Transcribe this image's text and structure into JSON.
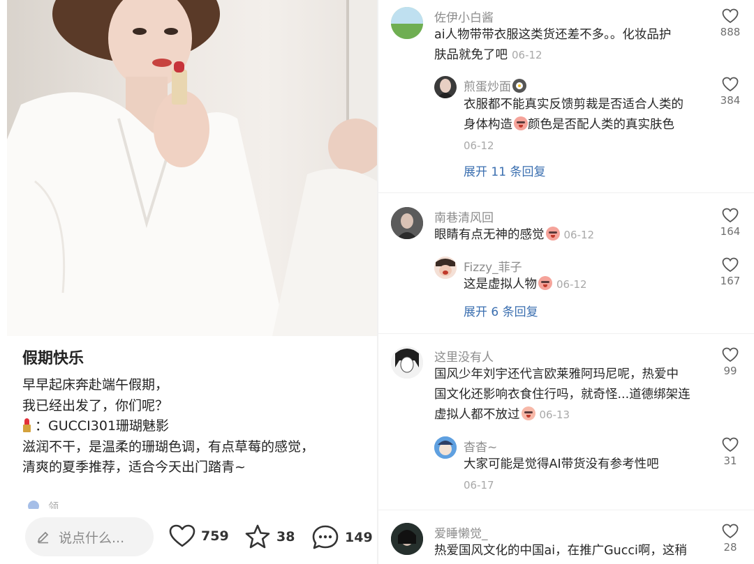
{
  "post": {
    "title": "假期快乐",
    "lines": [
      "早早起床奔赴端午假期，",
      "我已经出发了，你们呢？",
      "：GUCCI301珊瑚魅影",
      "滋润不干，是温柔的珊瑚色调，有点草莓的感觉，",
      "清爽的夏季推荐，适合今天出门踏青~"
    ],
    "lipstick_icon": "lipstick-emoji",
    "faded_text": "领"
  },
  "bottom_bar": {
    "say_placeholder": "说点什么...",
    "like_count": "759",
    "star_count": "38",
    "comment_count": "149"
  },
  "comments": [
    {
      "user": "佐伊小白酱",
      "lines": [
        "ai人物带带衣服这类货还差不多。。化妆品护",
        "肤品就免了吧"
      ],
      "date": "06-12",
      "likes": "888",
      "avatar_color": "#7fb36a",
      "replies": [
        {
          "user": "煎蛋炒面",
          "user_emoji": "pan-emoji",
          "lines": [
            "衣服都不能真实反馈剪裁是否适合人类的",
            "身体构造",
            "颜色是否配人类的真实肤色"
          ],
          "date": "06-12",
          "likes": "384",
          "avatar_color": "#3a3a3a"
        }
      ],
      "expand": "展开 11 条回复"
    },
    {
      "user": "南巷清风回",
      "lines": [
        "眼睛有点无神的感觉"
      ],
      "date": "06-12",
      "likes": "164",
      "avatar_color": "#4a4a4a",
      "replies": [
        {
          "user": "Fizzy_菲子",
          "lines": [
            "这是虚拟人物"
          ],
          "date": "06-12",
          "likes": "167",
          "avatar_color": "#e9b9a7"
        }
      ],
      "expand": "展开 6 条回复"
    },
    {
      "user": "这里没有人",
      "lines": [
        "国风少年刘宇还代言欧莱雅阿玛尼呢，热爱中",
        "国文化还影响衣食住行吗，就奇怪...道德绑架连",
        "虚拟人都不放过"
      ],
      "date": "06-13",
      "likes": "99",
      "avatar_color": "#dcdcdc",
      "replies": [
        {
          "user": "杳杳~",
          "lines": [
            "大家可能是觉得AI带货没有参考性吧"
          ],
          "date": "06-17",
          "likes": "31",
          "avatar_color": "#4f8fd1"
        }
      ]
    },
    {
      "user": "爱睡懒觉_",
      "lines": [
        "热爱国风文化的中国ai，在推广Gucci啊，这稍"
      ],
      "likes": "28",
      "avatar_color": "#2f3a36"
    }
  ],
  "colors": {
    "link_blue": "#3b6fb0",
    "username_gray": "#8c8c8c",
    "date_gray": "#a8a8a8"
  }
}
